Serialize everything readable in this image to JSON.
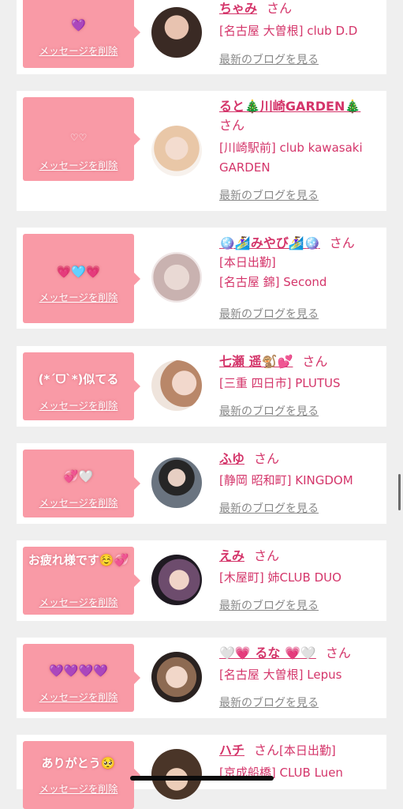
{
  "delete_label": "メッセージを削除",
  "san": "さん",
  "blog_label": "最新のブログを見る",
  "cards": [
    {
      "message": "💜",
      "name": "ちゃみ",
      "lines": [
        "[名古屋 大曽根] club D.D"
      ]
    },
    {
      "message": "♡♡",
      "name": "ると🎄川崎GARDEN🎄",
      "lines": [
        "[川崎駅前] club kawasaki",
        "GARDEN"
      ]
    },
    {
      "message": "💗🩵💗",
      "name": "🪩🏄‍♀️みやび🏄‍♀️🪩",
      "lines": [
        "[本日出勤]",
        "[名古屋 錦] Second"
      ]
    },
    {
      "message": "(*ˊᗜˋ*)似てる",
      "name": "七瀬 遥🐒💕",
      "lines": [
        "[三重 四日市] PLUTUS"
      ]
    },
    {
      "message": "💞🤍",
      "name": "ふゆ",
      "lines": [
        "[静岡 昭和町] KINGDOM"
      ]
    },
    {
      "message": "お疲れ様です☺️💞",
      "name": "えみ",
      "lines": [
        "[木屋町] 姉CLUB DUO"
      ]
    },
    {
      "message": "💜💜💜💜",
      "name": "🤍💗 るな 💗🤍",
      "lines": [
        "[名古屋 大曽根] Lepus"
      ]
    },
    {
      "message": "ありがとう🥺",
      "name": "ハチ",
      "san_suffix": "[本日出勤]",
      "lines": [
        "[京成船橋] CLUB Luen"
      ]
    }
  ],
  "colors": {
    "bubble": "#f99aa6",
    "accent": "#d4356a",
    "background": "#efefef"
  }
}
